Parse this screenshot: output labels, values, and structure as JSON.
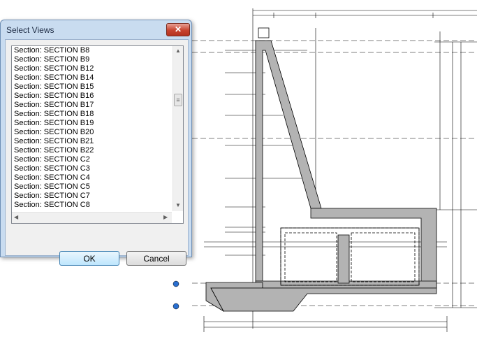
{
  "dialog": {
    "title": "Select Views",
    "close_glyph": "✕",
    "items": [
      "Section: SECTION B8",
      "Section: SECTION B9",
      "Section: SECTION B12",
      "Section: SECTION B14",
      "Section: SECTION B15",
      "Section: SECTION B16",
      "Section: SECTION B17",
      "Section: SECTION B18",
      "Section: SECTION B19",
      "Section: SECTION B20",
      "Section: SECTION B21",
      "Section: SECTION B22",
      "Section: SECTION C2",
      "Section: SECTION C3",
      "Section: SECTION C4",
      "Section: SECTION C5",
      "Section: SECTION C7",
      "Section: SECTION C8"
    ],
    "ok_label": "OK",
    "cancel_label": "Cancel"
  },
  "drawing": {
    "line_color": "#000000",
    "wall_fill": "#b3b3b3"
  }
}
